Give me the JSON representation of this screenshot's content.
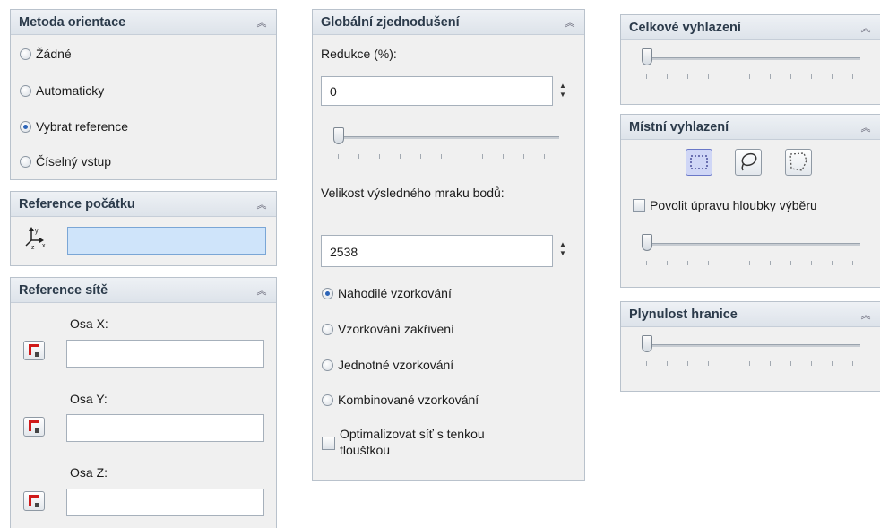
{
  "panel_orientation": {
    "title": "Metoda orientace",
    "options": [
      {
        "label": "Žádné",
        "selected": false
      },
      {
        "label": "Automaticky",
        "selected": false
      },
      {
        "label": "Vybrat reference",
        "selected": true
      },
      {
        "label": "Číselný vstup",
        "selected": false
      }
    ]
  },
  "panel_origin": {
    "title": "Reference počátku",
    "value": ""
  },
  "panel_mesh": {
    "title": "Reference sítě",
    "axes": [
      {
        "label": "Osa X:",
        "value": ""
      },
      {
        "label": "Osa Y:",
        "value": ""
      },
      {
        "label": "Osa Z:",
        "value": ""
      }
    ]
  },
  "panel_simplify": {
    "title": "Globální zjednodušení",
    "reduction_label": "Redukce (%):",
    "reduction_value": "0",
    "size_label": "Velikost výsledného mraku bodů:",
    "size_value": "2538",
    "options": [
      {
        "label": "Nahodilé vzorkování",
        "selected": true
      },
      {
        "label": "Vzorkování zakřivení",
        "selected": false
      },
      {
        "label": "Jednotné vzorkování",
        "selected": false
      },
      {
        "label": "Kombinované vzorkování",
        "selected": false
      }
    ],
    "optimize_label_1": "Optimalizovat síť s tenkou",
    "optimize_label_2": "tlouštkou"
  },
  "panel_overall": {
    "title": "Celkové vyhlazení"
  },
  "panel_local": {
    "title": "Místní vyhlazení",
    "depth_label": "Povolit úpravu hloubky výběru"
  },
  "panel_boundary": {
    "title": "Plynulost hranice"
  }
}
